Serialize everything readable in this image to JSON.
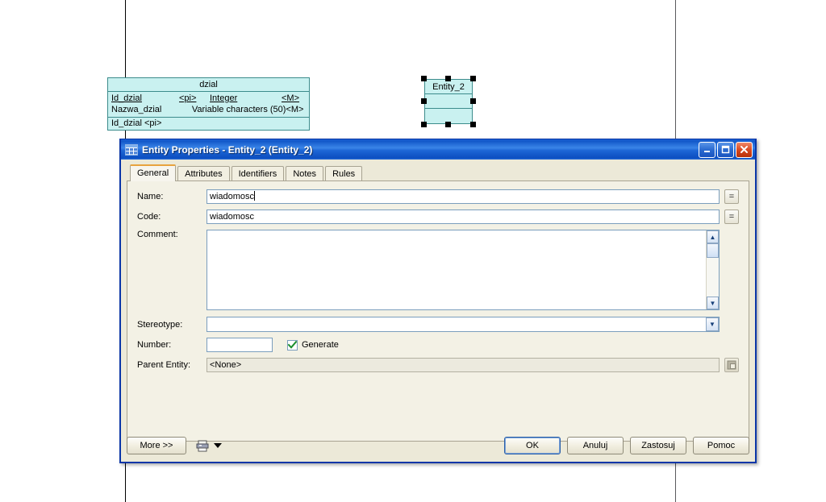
{
  "canvas": {
    "entities": [
      {
        "id": "dzial",
        "name": "dzial",
        "attributes": [
          {
            "name": "Id_dzial",
            "key": "<pi>",
            "type": "Integer",
            "mandatory": "<M>"
          },
          {
            "name": "Nazwa_dzial",
            "key": "",
            "type": "Variable characters (50)",
            "mandatory": "<M>"
          }
        ],
        "identifier": "Id_dzial  <pi>"
      },
      {
        "id": "entity_2",
        "name": "Entity_2",
        "selected": true
      }
    ],
    "fill_color": "#c9f1f0",
    "border_color": "#3c8c8c",
    "handle_color": "#000000"
  },
  "dialog": {
    "title": "Entity Properties - Entity_2 (Entity_2)",
    "title_icon": "table-grid-icon",
    "window_buttons": {
      "minimize": "minimize-icon",
      "maximize": "maximize-icon",
      "close": "close-icon"
    },
    "accent_title_color": "#1157c9",
    "active_tab_color": "#e8a33d",
    "tabs": [
      {
        "label": "General",
        "active": true
      },
      {
        "label": "Attributes",
        "active": false
      },
      {
        "label": "Identifiers",
        "active": false
      },
      {
        "label": "Notes",
        "active": false
      },
      {
        "label": "Rules",
        "active": false
      }
    ],
    "general": {
      "name_label": "Name:",
      "name_value": "wiadomosc",
      "name_equals_button": "=",
      "code_label": "Code:",
      "code_value": "wiadomosc",
      "code_equals_button": "=",
      "comment_label": "Comment:",
      "comment_value": "",
      "stereotype_label": "Stereotype:",
      "stereotype_value": "",
      "number_label": "Number:",
      "number_value": "",
      "generate_label": "Generate",
      "generate_checked": true,
      "parent_entity_label": "Parent Entity:",
      "parent_entity_value": "<None>"
    },
    "footer": {
      "more_label": "More >>",
      "print_icon": "printer-icon",
      "dropdown_icon": "chevron-down-icon",
      "ok_label": "OK",
      "cancel_label": "Anuluj",
      "apply_label": "Zastosuj",
      "help_label": "Pomoc"
    }
  }
}
